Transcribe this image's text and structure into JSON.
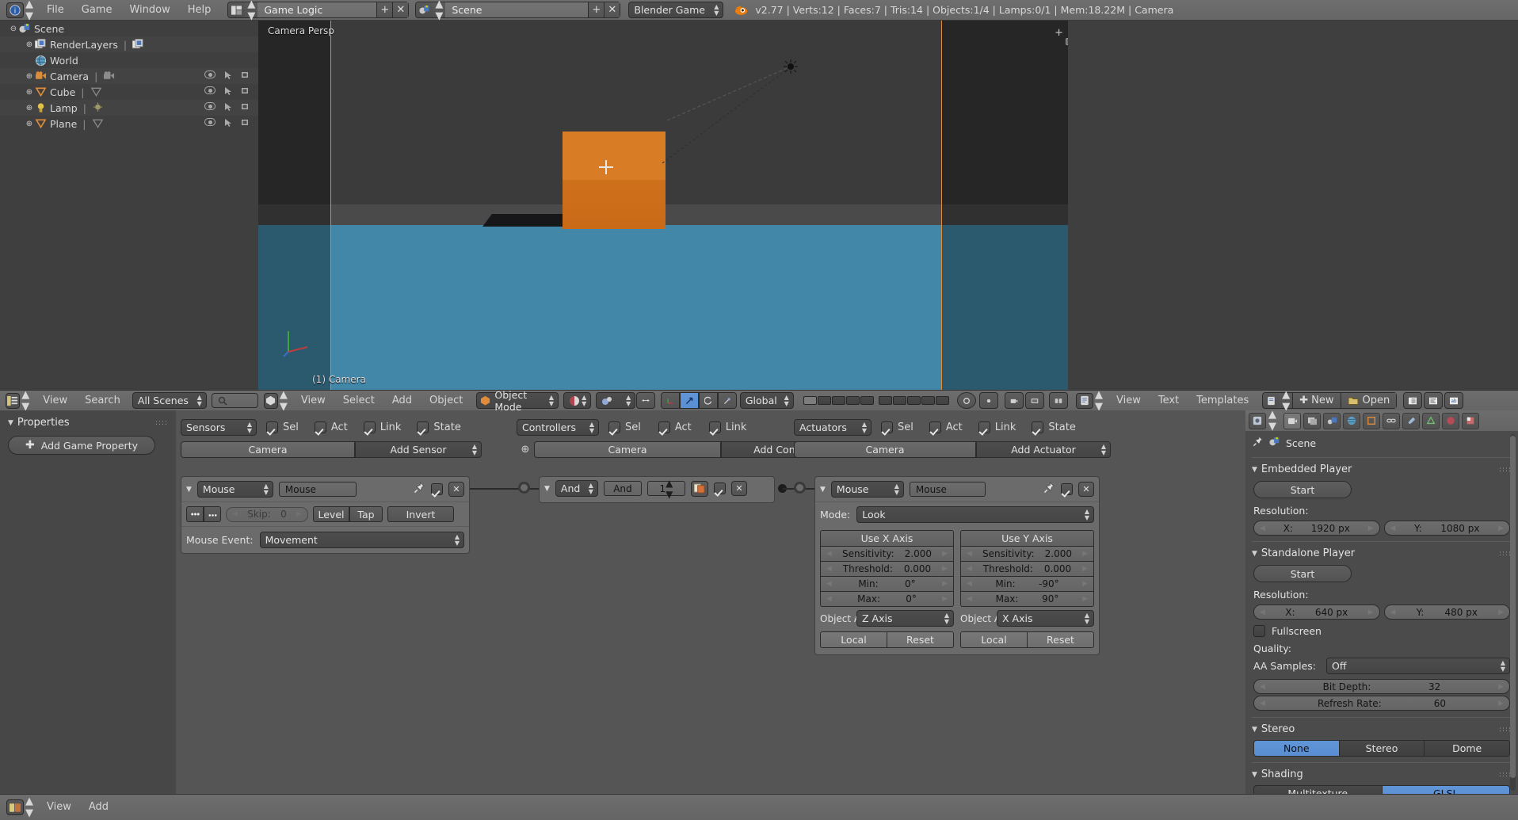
{
  "topbar": {
    "menus": [
      "File",
      "Game",
      "Window",
      "Help"
    ],
    "editor_selector_1": {
      "icon": "editor-type-icon",
      "value": "Game Logic"
    },
    "scene_selector": {
      "icon": "scene-icon",
      "value": "Scene"
    },
    "engine_selector": {
      "value": "Blender Game"
    },
    "new_label": "+",
    "close_label": "✕",
    "stats": "v2.77 | Verts:12 | Faces:7 | Tris:14 | Objects:1/4 | Lamps:0/1 | Mem:18.22M | Camera"
  },
  "outliner": {
    "header": {
      "icon": "outliner-icon",
      "menus": [
        "View",
        "Search"
      ],
      "display_mode": "All Scenes",
      "search_placeholder": ""
    },
    "rows": [
      {
        "label": "Scene",
        "indent": 0,
        "icon": "scene-icon",
        "expander": "⊖",
        "has_toggles": false
      },
      {
        "label": "RenderLayers",
        "indent": 1,
        "icon": "renderlayers-icon",
        "expander": "⊕",
        "has_toggles": false,
        "second_icon": "renderlayers-icon"
      },
      {
        "label": "World",
        "indent": 1,
        "icon": "world-icon",
        "expander": "",
        "has_toggles": false
      },
      {
        "label": "Camera",
        "indent": 1,
        "icon": "camera-icon",
        "expander": "⊕",
        "has_toggles": true,
        "second_icon": "camera-data-icon"
      },
      {
        "label": "Cube",
        "indent": 1,
        "icon": "mesh-icon",
        "expander": "⊕",
        "has_toggles": true,
        "second_icon": "mesh-data-icon"
      },
      {
        "label": "Lamp",
        "indent": 1,
        "icon": "lamp-icon",
        "expander": "⊕",
        "has_toggles": true,
        "second_icon": "lamp-data-icon"
      },
      {
        "label": "Plane",
        "indent": 1,
        "icon": "mesh-icon",
        "expander": "⊕",
        "has_toggles": false,
        "second_icon": "mesh-data-icon"
      }
    ]
  },
  "viewport": {
    "header": {
      "menus": [
        "View",
        "Select",
        "Add",
        "Object"
      ],
      "mode": "Object Mode",
      "orientation": "Global"
    },
    "view_label": "Camera Persp",
    "active_object_label": "(1) Camera"
  },
  "text_editor": {
    "header": {
      "menus": [
        "View",
        "Text",
        "Templates"
      ],
      "new_label": "New",
      "open_label": "Open"
    }
  },
  "game_properties": {
    "panel_title": "Properties",
    "add_button": "Add Game Property"
  },
  "logic": {
    "sensors": {
      "selector": "Sensors",
      "filters": [
        {
          "label": "Sel",
          "checked": true
        },
        {
          "label": "Act",
          "checked": true
        },
        {
          "label": "Link",
          "checked": true
        },
        {
          "label": "State",
          "checked": true
        }
      ],
      "object_name": "Camera",
      "add_button": "Add Sensor",
      "block": {
        "type": "Mouse",
        "name": "Mouse",
        "pin": true,
        "enabled": true,
        "close": "✕",
        "skip_label": "Skip:",
        "skip_value": "0",
        "level_label": "Level",
        "tap_label": "Tap",
        "invert_label": "Invert",
        "mouse_event_label": "Mouse Event:",
        "mouse_event_value": "Movement"
      }
    },
    "controllers": {
      "selector": "Controllers",
      "filters": [
        {
          "label": "Sel",
          "checked": true
        },
        {
          "label": "Act",
          "checked": true
        },
        {
          "label": "Link",
          "checked": true
        }
      ],
      "object_name": "Camera",
      "add_button": "Add Controller",
      "block": {
        "type": "And",
        "name": "And",
        "state_value": "1",
        "enabled": true,
        "close": "✕"
      }
    },
    "actuators": {
      "selector": "Actuators",
      "filters": [
        {
          "label": "Sel",
          "checked": true
        },
        {
          "label": "Act",
          "checked": true
        },
        {
          "label": "Link",
          "checked": true
        },
        {
          "label": "State",
          "checked": true
        }
      ],
      "object_name": "Camera",
      "add_button": "Add Actuator",
      "block": {
        "type": "Mouse",
        "name": "Mouse",
        "pin": true,
        "enabled": true,
        "close": "✕",
        "mode_label": "Mode:",
        "mode_value": "Look",
        "x_axis": {
          "title": "Use X Axis",
          "sensitivity_label": "Sensitivity:",
          "sensitivity_value": "2.000",
          "threshold_label": "Threshold:",
          "threshold_value": "0.000",
          "min_label": "Min:",
          "min_value": "0°",
          "max_label": "Max:",
          "max_value": "0°",
          "object_axis_label": "Object A",
          "object_axis_value": "Z Axis",
          "local_label": "Local",
          "reset_label": "Reset"
        },
        "y_axis": {
          "title": "Use Y Axis",
          "sensitivity_label": "Sensitivity:",
          "sensitivity_value": "2.000",
          "threshold_label": "Threshold:",
          "threshold_value": "0.000",
          "min_label": "Min:",
          "min_value": "-90°",
          "max_label": "Max:",
          "max_value": "90°",
          "object_axis_label": "Object A",
          "object_axis_value": "X Axis",
          "local_label": "Local",
          "reset_label": "Reset"
        }
      }
    }
  },
  "render_properties": {
    "breadcrumb": "Scene",
    "embedded_player": {
      "title": "Embedded Player",
      "start_label": "Start",
      "resolution_label": "Resolution:",
      "x_label": "X:",
      "x_value": "1920 px",
      "y_label": "Y:",
      "y_value": "1080 px"
    },
    "standalone_player": {
      "title": "Standalone Player",
      "start_label": "Start",
      "resolution_label": "Resolution:",
      "x_label": "X:",
      "x_value": "640 px",
      "y_label": "Y:",
      "y_value": "480 px",
      "fullscreen_label": "Fullscreen",
      "fullscreen_checked": false,
      "quality_label": "Quality:",
      "aa_label": "AA Samples:",
      "aa_value": "Off",
      "bit_depth_label": "Bit Depth:",
      "bit_depth_value": "32",
      "refresh_label": "Refresh Rate:",
      "refresh_value": "60"
    },
    "stereo": {
      "title": "Stereo",
      "options": [
        "None",
        "Stereo",
        "Dome"
      ],
      "selected": "None"
    },
    "shading": {
      "title": "Shading",
      "options": [
        "Multitexture",
        "GLSL"
      ],
      "selected": "GLSL"
    }
  },
  "statusbar": {
    "menus": [
      "View",
      "Add"
    ]
  },
  "colors": {
    "accent_blue": "#5a8ed2",
    "orange": "#d4761f",
    "water": "#4287a8",
    "panel": "#555555"
  }
}
